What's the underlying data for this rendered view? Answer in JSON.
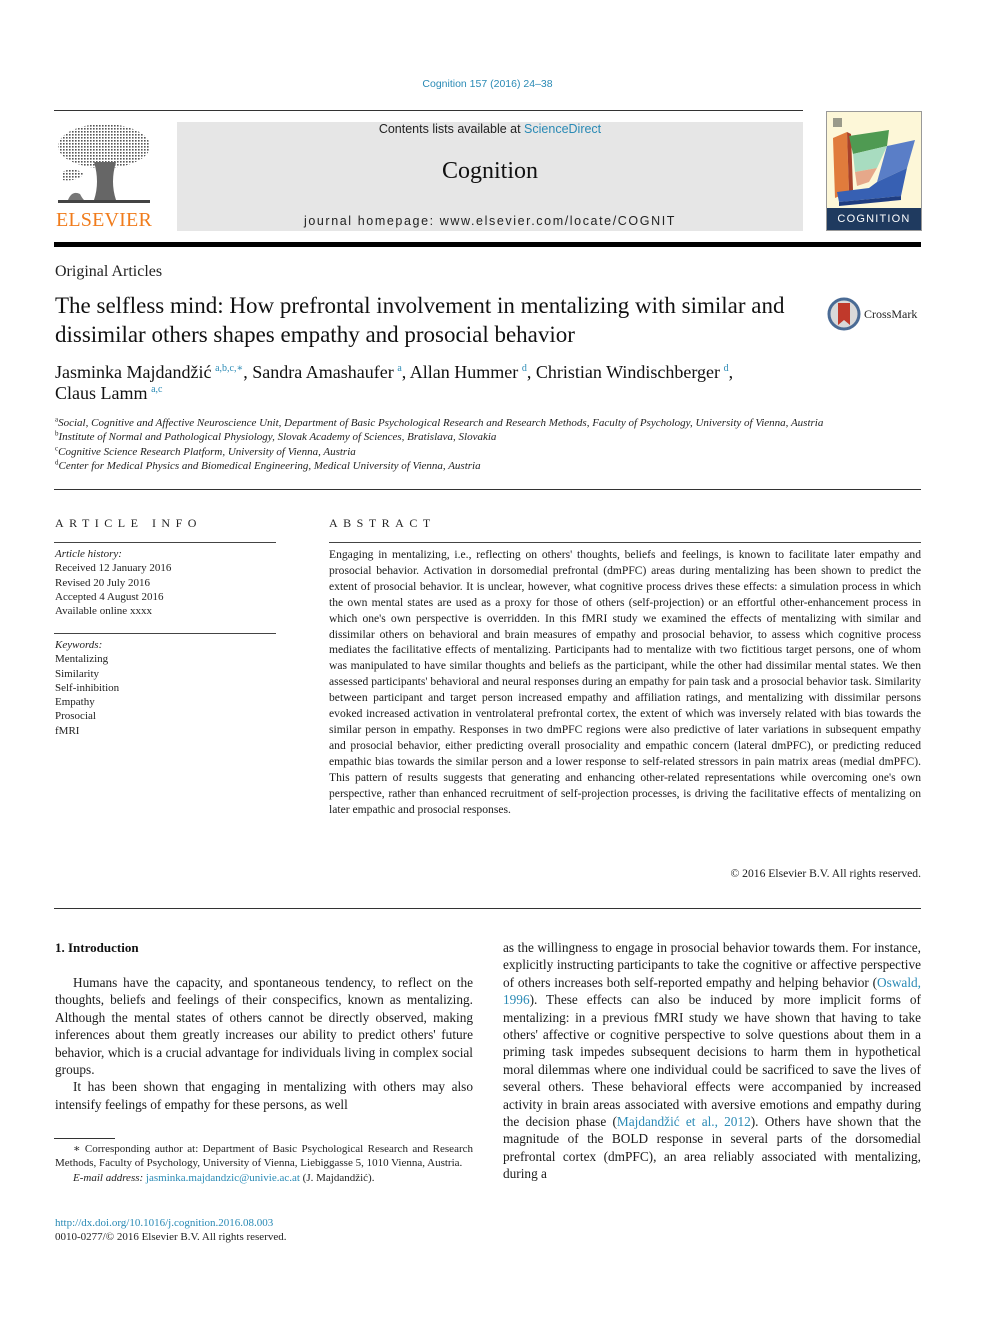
{
  "header": {
    "citation": "Cognition 157 (2016) 24–38",
    "contents_prefix": "Contents lists available at ",
    "contents_link": "ScienceDirect",
    "journal_name": "Cognition",
    "homepage": "journal homepage: www.elsevier.com/locate/COGNIT",
    "publisher_logo_text": "ELSEVIER",
    "cover_title": "COGNITION",
    "colors": {
      "link": "#2a8ab5",
      "elsevier_orange": "#f07c1c",
      "masthead_bg": "#e6e6e6",
      "cover_band": "#1f3a5f"
    }
  },
  "article": {
    "section": "Original Articles",
    "title": "The selfless mind: How prefrontal involvement in mentalizing with similar and dissimilar others shapes empathy and prosocial behavior",
    "crossmark_label": "CrossMark",
    "authors": [
      {
        "name": "Jasminka Majdandžić",
        "sup": "a,b,c,∗",
        "sep": ", "
      },
      {
        "name": "Sandra Amashaufer",
        "sup": "a",
        "sep": ", "
      },
      {
        "name": "Allan Hummer",
        "sup": "d",
        "sep": ", "
      },
      {
        "name": "Christian Windischberger",
        "sup": "d",
        "sep": ","
      },
      {
        "name": "Claus Lamm",
        "sup": "a,c",
        "sep": ""
      }
    ],
    "affiliations": [
      {
        "key": "a",
        "text": "Social, Cognitive and Affective Neuroscience Unit, Department of Basic Psychological Research and Research Methods, Faculty of Psychology, University of Vienna, Austria"
      },
      {
        "key": "b",
        "text": "Institute of Normal and Pathological Physiology, Slovak Academy of Sciences, Bratislava, Slovakia"
      },
      {
        "key": "c",
        "text": "Cognitive Science Research Platform, University of Vienna, Austria"
      },
      {
        "key": "d",
        "text": "Center for Medical Physics and Biomedical Engineering, Medical University of Vienna, Austria"
      }
    ]
  },
  "article_info": {
    "heading": "ARTICLE INFO",
    "history_title": "Article history:",
    "history": [
      "Received 12 January 2016",
      "Revised 20 July 2016",
      "Accepted 4 August 2016",
      "Available online xxxx"
    ],
    "keywords_title": "Keywords:",
    "keywords": [
      "Mentalizing",
      "Similarity",
      "Self-inhibition",
      "Empathy",
      "Prosocial",
      "fMRI"
    ]
  },
  "abstract": {
    "heading": "ABSTRACT",
    "text": "Engaging in mentalizing, i.e., reflecting on others' thoughts, beliefs and feelings, is known to facilitate later empathy and prosocial behavior. Activation in dorsomedial prefrontal (dmPFC) areas during mentalizing has been shown to predict the extent of prosocial behavior. It is unclear, however, what cognitive process drives these effects: a simulation process in which the own mental states are used as a proxy for those of others (self-projection) or an effortful other-enhancement process in which one's own perspective is overridden. In this fMRI study we examined the effects of mentalizing with similar and dissimilar others on behavioral and brain measures of empathy and prosocial behavior, to assess which cognitive process mediates the facilitative effects of mentalizing. Participants had to mentalize with two fictitious target persons, one of whom was manipulated to have similar thoughts and beliefs as the participant, while the other had dissimilar mental states. We then assessed participants' behavioral and neural responses during an empathy for pain task and a prosocial behavior task. Similarity between participant and target person increased empathy and affiliation ratings, and mentalizing with dissimilar persons evoked increased activation in ventrolateral prefrontal cortex, the extent of which was inversely related with bias towards the similar person in empathy. Responses in two dmPFC regions were also predictive of later variations in subsequent empathy and prosocial behavior, either predicting overall prosociality and empathic concern (lateral dmPFC), or predicting reduced empathic bias towards the similar person and a lower response to self-related stressors in pain matrix areas (medial dmPFC). This pattern of results suggests that generating and enhancing other-related representations while overcoming one's own perspective, rather than enhanced recruitment of self-projection processes, is driving the facilitative effects of mentalizing on later empathic and prosocial responses.",
    "copyright": "© 2016 Elsevier B.V. All rights reserved."
  },
  "body": {
    "intro_heading": "1. Introduction",
    "left_paragraphs": [
      "Humans have the capacity, and spontaneous tendency, to reflect on the thoughts, beliefs and feelings of their conspecifics, known as mentalizing. Although the mental states of others cannot be directly observed, making inferences about them greatly increases our ability to predict others' future behavior, which is a crucial advantage for individuals living in complex social groups.",
      "It has been shown that engaging in mentalizing with others may also intensify feelings of empathy for these persons, as well"
    ],
    "right": {
      "part1": "as the willingness to engage in prosocial behavior towards them. For instance, explicitly instructing participants to take the cognitive or affective perspective of others increases both self-reported empathy and helping behavior (",
      "ref1": "Oswald, 1996",
      "part2": "). These effects can also be induced by more implicit forms of mentalizing: in a previous fMRI study we have shown that having to take others' affective or cognitive perspective to solve questions about them in a priming task impedes subsequent decisions to harm them in hypothetical moral dilemmas where one individual could be sacrificed to save the lives of several others. These behavioral effects were accompanied by increased activity in brain areas associated with aversive emotions and empathy during the decision phase (",
      "ref2": "Majdandžić et al., 2012",
      "part3": "). Others have shown that the magnitude of the BOLD response in several parts of the dorsomedial prefrontal cortex (dmPFC), an area reliably associated with mentalizing, during a"
    }
  },
  "footnotes": {
    "corresponding": "∗ Corresponding author at: Department of Basic Psychological Research and Research Methods, Faculty of Psychology, University of Vienna, Liebiggasse 5, 1010 Vienna, Austria.",
    "email_label": "E-mail address: ",
    "email": "jasminka.majdandzic@univie.ac.at",
    "email_suffix": " (J. Majdandžić).",
    "doi": "http://dx.doi.org/10.1016/j.cognition.2016.08.003",
    "issn": "0010-0277/© 2016 Elsevier B.V. All rights reserved."
  }
}
